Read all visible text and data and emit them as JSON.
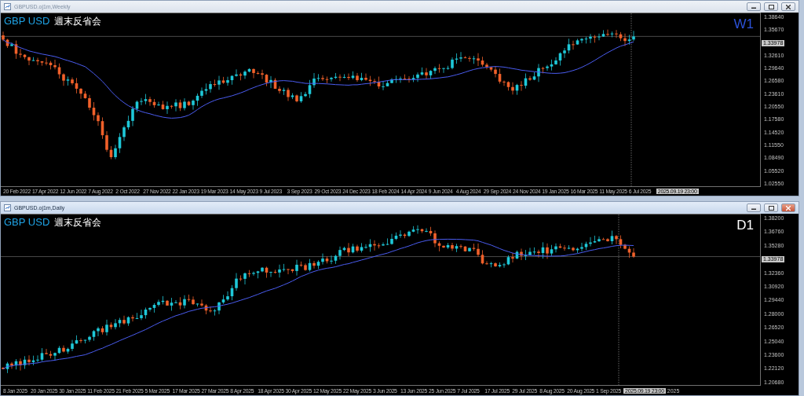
{
  "windows": [
    {
      "title": "GBPUSD.oj1m,Weekly",
      "active": false,
      "overlay": {
        "symbol": "GBP USD",
        "caption": "週末反省会",
        "timeframe": "W1"
      },
      "price_axis": [
        {
          "text": "1.38640",
          "kind": "tick"
        },
        {
          "text": "1.35670",
          "kind": "tick"
        },
        {
          "text": "1.33978",
          "kind": "current"
        },
        {
          "text": "1.32610",
          "kind": "tick"
        },
        {
          "text": "1.29640",
          "kind": "tick"
        },
        {
          "text": "1.26580",
          "kind": "tick"
        },
        {
          "text": "1.23610",
          "kind": "tick"
        },
        {
          "text": "1.20550",
          "kind": "tick"
        },
        {
          "text": "1.17580",
          "kind": "tick"
        },
        {
          "text": "1.14520",
          "kind": "tick"
        },
        {
          "text": "1.11550",
          "kind": "tick"
        },
        {
          "text": "1.08490",
          "kind": "tick"
        },
        {
          "text": "1.05520",
          "kind": "tick"
        },
        {
          "text": "1.02550",
          "kind": "tick"
        }
      ],
      "time_axis": {
        "labels": [
          "20 Feb 2022",
          "17 Apr 2022",
          "12 Jun 2022",
          "7 Aug 2022",
          "2 Oct 2022",
          "27 Nov 2022",
          "22 Jan 2023",
          "19 Mar 2023",
          "14 May 2023",
          "9 Jul 2023",
          "3 Sep 2023",
          "29 Oct 2023",
          "24 Dec 2023",
          "18 Feb 2024",
          "14 Apr 2024",
          "9 Jun 2024",
          "4 Aug 2024",
          "29 Sep 2024",
          "24 Nov 2024",
          "19 Jan 2025",
          "16 Mar 2025",
          "11 May 2025",
          "6 Jul 2025"
        ],
        "crosshair_time": "2025.09.19 23:00"
      }
    },
    {
      "title": "GBPUSD.oj1m,Daily",
      "active": true,
      "overlay": {
        "symbol": "GBP USD",
        "caption": "週末反省会",
        "timeframe": "D1"
      },
      "price_axis": [
        {
          "text": "1.38200",
          "kind": "tick"
        },
        {
          "text": "1.36760",
          "kind": "tick"
        },
        {
          "text": "1.35280",
          "kind": "tick"
        },
        {
          "text": "1.33978",
          "kind": "current"
        },
        {
          "text": "1.32360",
          "kind": "tick"
        },
        {
          "text": "1.30920",
          "kind": "tick"
        },
        {
          "text": "1.29440",
          "kind": "tick"
        },
        {
          "text": "1.28000",
          "kind": "tick"
        },
        {
          "text": "1.26520",
          "kind": "tick"
        },
        {
          "text": "1.25040",
          "kind": "tick"
        },
        {
          "text": "1.23600",
          "kind": "tick"
        },
        {
          "text": "1.22120",
          "kind": "tick"
        },
        {
          "text": "1.20680",
          "kind": "tick"
        }
      ],
      "time_axis": {
        "labels": [
          "8 Jan 2025",
          "20 Jan 2025",
          "30 Jan 2025",
          "11 Feb 2025",
          "21 Feb 2025",
          "5 Mar 2025",
          "17 Mar 2025",
          "27 Mar 2025",
          "8 Apr 2025",
          "18 Apr 2025",
          "30 Apr 2025",
          "12 May 2025",
          "22 May 2025",
          "3 Jun 2025",
          "13 Jun 2025",
          "25 Jun 2025",
          "7 Jul 2025",
          "17 Jul 2025",
          "29 Jul 2025",
          "8 Aug 2025",
          "20 Aug 2025",
          "1 Sep 2025"
        ],
        "crosshair_time": "2025.09.19 23:00",
        "trailing": "2025"
      }
    }
  ]
}
